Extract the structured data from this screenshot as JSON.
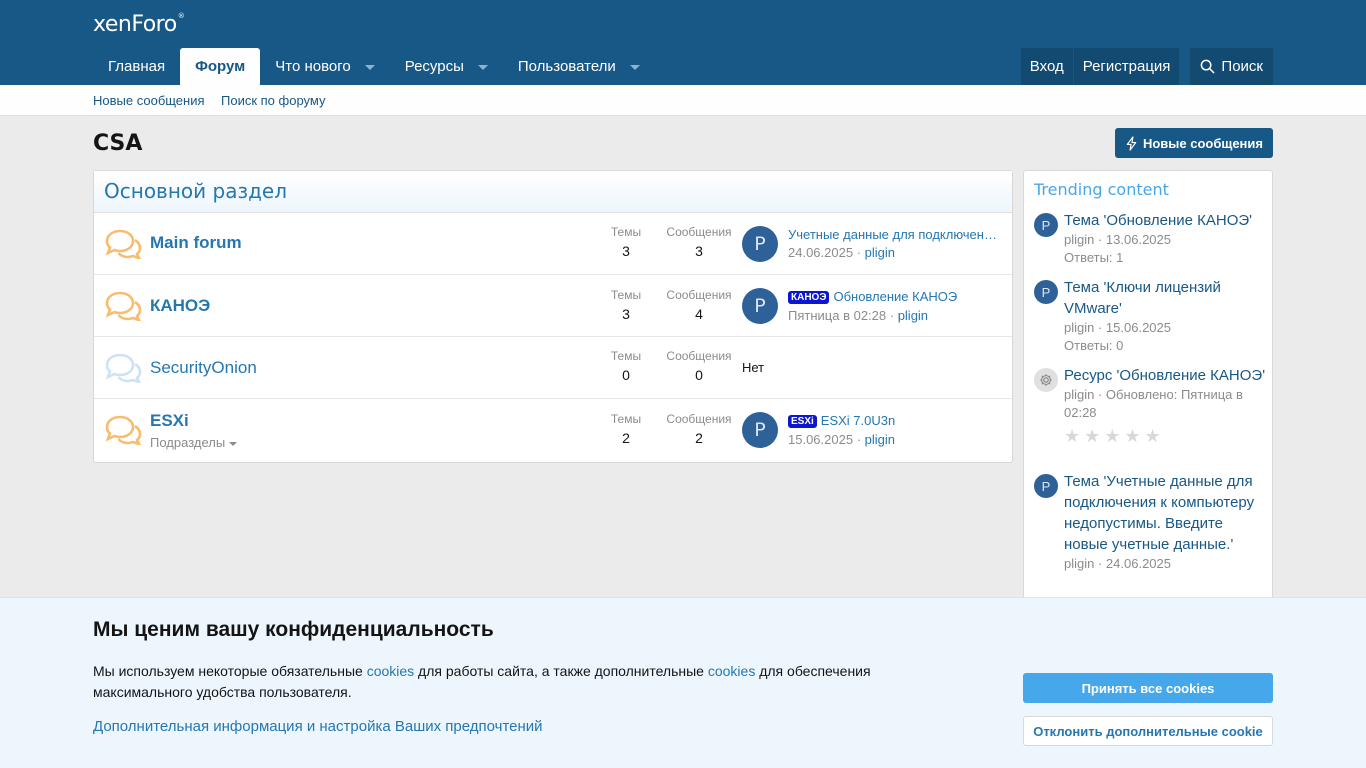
{
  "header": {
    "logo": "xenForo",
    "nav": [
      {
        "label": "Главная"
      },
      {
        "label": "Форум"
      },
      {
        "label": "Что нового"
      },
      {
        "label": "Ресурсы"
      },
      {
        "label": "Пользователи"
      }
    ],
    "login": "Вход",
    "register": "Регистрация",
    "search": "Поиск"
  },
  "subnav": {
    "new_posts": "Новые сообщения",
    "search_forum": "Поиск по форуму"
  },
  "page": {
    "title": "CSA",
    "new_posts_button": "Новые сообщения"
  },
  "forum": {
    "category": "Основной раздел",
    "stat_threads_label": "Темы",
    "stat_posts_label": "Сообщения",
    "nodes": [
      {
        "title": "Main forum",
        "threads": "3",
        "posts": "3",
        "avatar": "P",
        "last_label": "",
        "last_title": "Учетные данные для подключения к компьютеру недопустимы. Введите новые учетные данные.",
        "last_date": "24.06.2025",
        "last_user": "pligin"
      },
      {
        "title": "КАНОЭ",
        "threads": "3",
        "posts": "4",
        "avatar": "P",
        "last_label": "КАНОЭ",
        "last_title": "Обновление КАНОЭ",
        "last_date": "Пятница в 02:28",
        "last_user": "pligin"
      },
      {
        "title": "SecurityOnion",
        "threads": "0",
        "posts": "0",
        "none": "Нет"
      },
      {
        "title": "ESXi",
        "subforums": "Подразделы",
        "threads": "2",
        "posts": "2",
        "avatar": "P",
        "last_label": "ESXi",
        "last_title": "ESXi 7.0U3n",
        "last_date": "15.06.2025",
        "last_user": "pligin"
      }
    ]
  },
  "sidebar": {
    "title": "Trending content",
    "items": [
      {
        "avatar": "P",
        "title": "Тема 'Обновление КАНОЭ'",
        "meta_user": "pligin",
        "meta_date": "13.06.2025",
        "replies": "Ответы: 1"
      },
      {
        "avatar": "P",
        "title": "Тема 'Ключи лицензий VMware'",
        "meta_user": "pligin",
        "meta_date": "15.06.2025",
        "replies": "Ответы: 0"
      },
      {
        "avatar": "gear-icon",
        "title": "Ресурс 'Обновление КАНОЭ'",
        "meta_user": "pligin",
        "meta_date": "Обновлено: Пятница в 02:28",
        "stars": "★★★★★"
      },
      {
        "avatar": "P",
        "title": "Тема 'Учетные данные для подключения к компьютеру недопустимы. Введите новые учетные данные.'",
        "meta_user": "pligin",
        "meta_date": "24.06.2025"
      }
    ]
  },
  "cookie": {
    "title": "Мы ценим вашу конфиденциальность",
    "text_1": "Мы используем некоторые обязательные ",
    "link_1": "cookies",
    "text_2": " для работы сайта, а также дополнительные ",
    "link_2": "cookies",
    "text_3": " для обеспечения максимального удобства пользователя.",
    "more": "Дополнительная информация и настройка Ваших предпочтений",
    "accept": "Принять все cookies",
    "reject": "Отклонить дополнительные cookie"
  },
  "colors": {
    "header": "#185886",
    "link": "#2577b1",
    "accent": "#47a7eb",
    "label": "#0d16cf"
  }
}
